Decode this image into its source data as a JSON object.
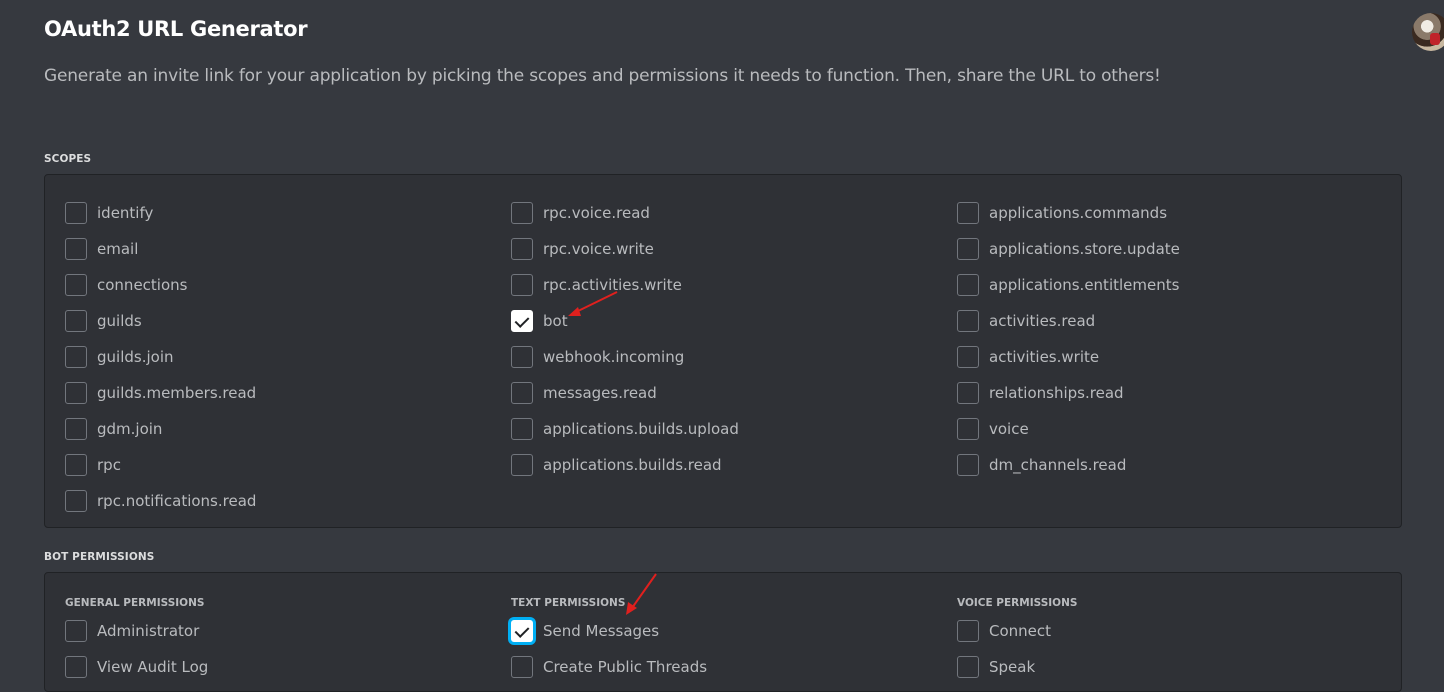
{
  "header": {
    "title": "OAuth2 URL Generator",
    "description": "Generate an invite link for your application by picking the scopes and permissions it needs to function. Then, share the URL to others!"
  },
  "scopes": {
    "label": "SCOPES",
    "columns": [
      [
        {
          "label": "identify",
          "checked": false
        },
        {
          "label": "email",
          "checked": false
        },
        {
          "label": "connections",
          "checked": false
        },
        {
          "label": "guilds",
          "checked": false
        },
        {
          "label": "guilds.join",
          "checked": false
        },
        {
          "label": "guilds.members.read",
          "checked": false
        },
        {
          "label": "gdm.join",
          "checked": false
        },
        {
          "label": "rpc",
          "checked": false
        },
        {
          "label": "rpc.notifications.read",
          "checked": false
        }
      ],
      [
        {
          "label": "rpc.voice.read",
          "checked": false
        },
        {
          "label": "rpc.voice.write",
          "checked": false
        },
        {
          "label": "rpc.activities.write",
          "checked": false
        },
        {
          "label": "bot",
          "checked": true
        },
        {
          "label": "webhook.incoming",
          "checked": false
        },
        {
          "label": "messages.read",
          "checked": false
        },
        {
          "label": "applications.builds.upload",
          "checked": false
        },
        {
          "label": "applications.builds.read",
          "checked": false
        }
      ],
      [
        {
          "label": "applications.commands",
          "checked": false
        },
        {
          "label": "applications.store.update",
          "checked": false
        },
        {
          "label": "applications.entitlements",
          "checked": false
        },
        {
          "label": "activities.read",
          "checked": false
        },
        {
          "label": "activities.write",
          "checked": false
        },
        {
          "label": "relationships.read",
          "checked": false
        },
        {
          "label": "voice",
          "checked": false
        },
        {
          "label": "dm_channels.read",
          "checked": false
        }
      ]
    ]
  },
  "bot_permissions": {
    "label": "BOT PERMISSIONS",
    "columns": [
      {
        "header": "GENERAL PERMISSIONS",
        "items": [
          {
            "label": "Administrator",
            "checked": false
          },
          {
            "label": "View Audit Log",
            "checked": false
          }
        ]
      },
      {
        "header": "TEXT PERMISSIONS",
        "items": [
          {
            "label": "Send Messages",
            "checked": true,
            "focused": true
          },
          {
            "label": "Create Public Threads",
            "checked": false
          }
        ]
      },
      {
        "header": "VOICE PERMISSIONS",
        "items": [
          {
            "label": "Connect",
            "checked": false
          },
          {
            "label": "Speak",
            "checked": false
          }
        ]
      }
    ]
  },
  "colors": {
    "background": "#36393f",
    "panel": "#2f3136",
    "focus_ring": "#00aff4",
    "annotation_arrow": "#e0201e"
  },
  "icons": {
    "checkbox_checked": "check-icon",
    "avatar": "user-avatar",
    "annotation": "red-arrow-icon"
  }
}
